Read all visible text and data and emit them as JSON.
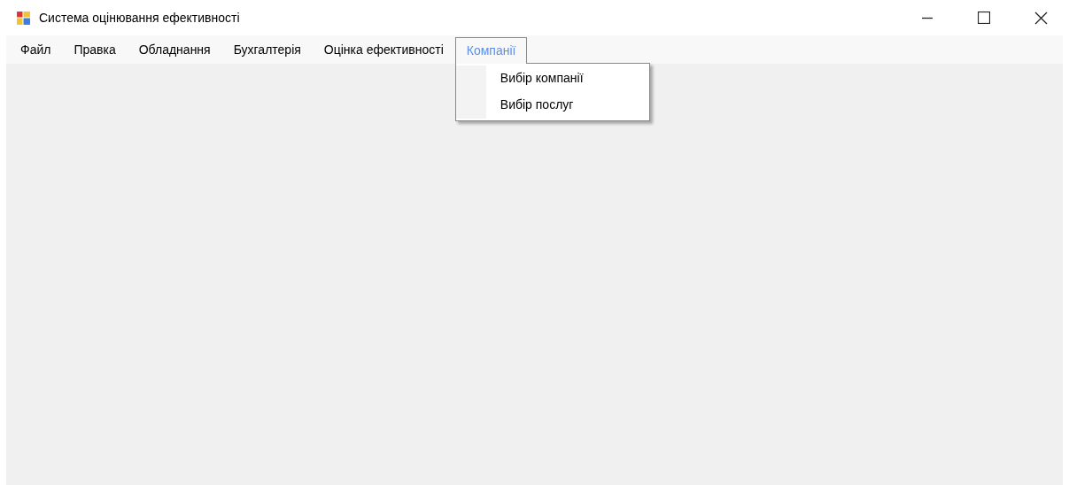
{
  "window": {
    "title": "Система оцінювання ефективності"
  },
  "menu": [
    {
      "label": "Файл",
      "selected": false
    },
    {
      "label": "Правка",
      "selected": false
    },
    {
      "label": "Обладнання",
      "selected": false
    },
    {
      "label": "Бухгалтерія",
      "selected": false
    },
    {
      "label": "Оцінка ефективності",
      "selected": false
    },
    {
      "label": "Компанії",
      "selected": true,
      "items": [
        "Вибір компанії",
        "Вибір послуг"
      ]
    }
  ]
}
